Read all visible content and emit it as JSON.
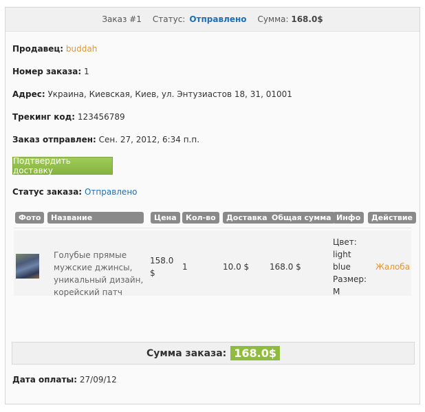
{
  "header": {
    "order_label": "Заказ #1",
    "status_label": "Статус:",
    "status_value": "Отправлено",
    "sum_label": "Сумма:",
    "sum_value": "168.0$"
  },
  "details": {
    "seller_label": "Продавец:",
    "seller_value": "buddah",
    "order_no_label": "Номер заказа:",
    "order_no_value": "1",
    "address_label": "Адрес:",
    "address_value": "Украина, Киевская, Киев, ул. Энтузиастов 18, 31, 01001",
    "tracking_label": "Трекинг код:",
    "tracking_value": "123456789",
    "sent_label": "Заказ отправлен:",
    "sent_value": "Сен. 27, 2012, 6:34 п.п."
  },
  "confirm_button": "Подтвердить доставку",
  "order_status": {
    "label": "Статус заказа:",
    "value": "Отправлено"
  },
  "table": {
    "headers": [
      "Фото",
      "Название",
      "Цена",
      "Кол-во",
      "Доставка",
      "Общая сумма",
      "Инфо",
      "Действие"
    ],
    "row": {
      "name": "Голубые прямые мужские джинсы, уникальный дизайн, корейский патч",
      "price": "158.0 $",
      "qty": "1",
      "delivery": "10.0 $",
      "total": "168.0 $",
      "info": "Цвет: light blue Размер: M",
      "action": "Жалоба"
    }
  },
  "summary": {
    "label": "Сумма заказа:",
    "value": "168.0$"
  },
  "payment": {
    "label": "Дата оплаты:",
    "value": "27/09/12"
  }
}
